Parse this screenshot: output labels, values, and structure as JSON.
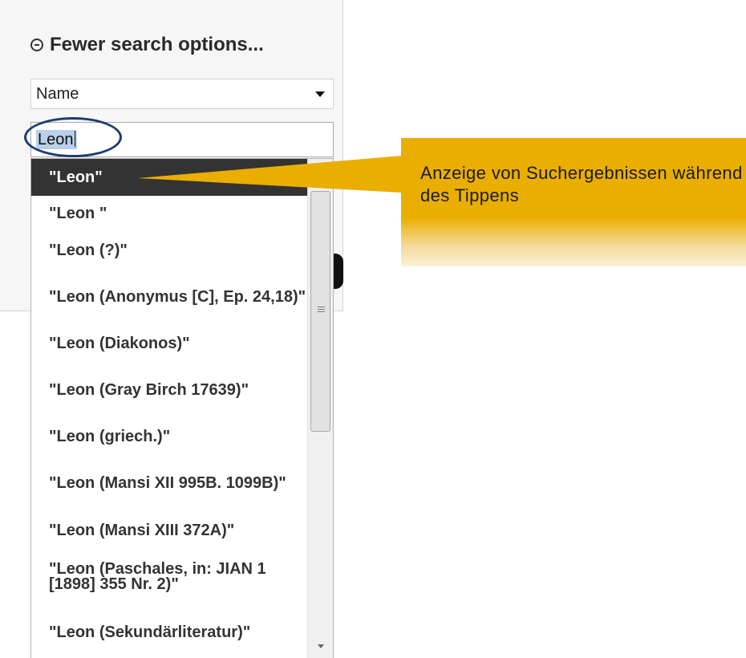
{
  "search_options": {
    "toggle_label": "Fewer search options...",
    "field_select": {
      "selected": "Name"
    },
    "query_input": {
      "value": "Leon"
    }
  },
  "autocomplete": {
    "items": [
      "\"Leon\"",
      "\"Leon \"",
      "\"Leon (?)\"",
      "\"Leon (Anonymus [C], Ep. 24,18)\"",
      "\"Leon (Diakonos)\"",
      "\"Leon (Gray Birch 17639)\"",
      "\"Leon (griech.)\"",
      "\"Leon (Mansi XII 995B. 1099B)\"",
      "\"Leon (Mansi XIII 372A)\"",
      "\"Leon (Paschales, in: JIAN 1 [1898] 355 Nr. 2)\"",
      "\"Leon (Sekundärliteratur)\""
    ],
    "active_index": 0
  },
  "callout": {
    "text": "Anzeige von Suchergebnissen während des Tippens"
  },
  "colors": {
    "callout_bg": "#e9ae00",
    "active_item_bg": "#333333",
    "ellipse_border": "#1f3b70"
  }
}
